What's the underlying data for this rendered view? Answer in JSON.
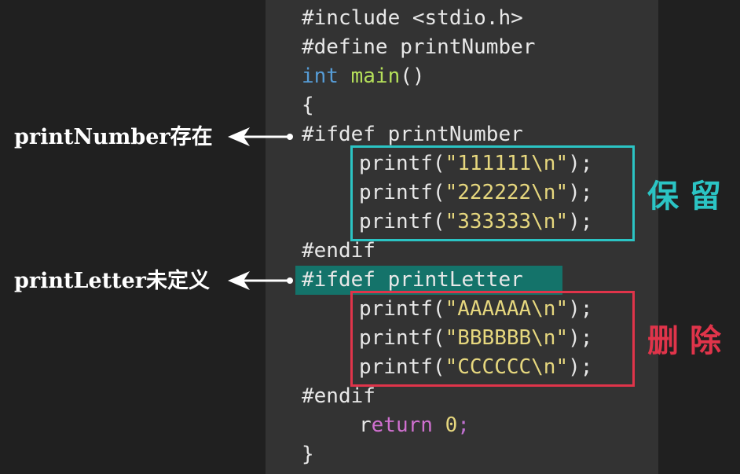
{
  "code": {
    "line1": "#include <stdio.h>",
    "line2": "#define printNumber",
    "line3_kw": "int",
    "line3_fn": "main",
    "line3_rest": "()",
    "line4": "{",
    "line5": "#ifdef printNumber",
    "p1_pre": "printf(",
    "p1_str": "\"111111\\n\"",
    "p1_post": ");",
    "p2_pre": "printf(",
    "p2_str": "\"222222\\n\"",
    "p2_post": ");",
    "p3_pre": "printf(",
    "p3_str": "\"333333\\n\"",
    "p3_post": ");",
    "endif1": "#endif",
    "line_ifdef2": "#ifdef printLetter",
    "p4_pre": "printf(",
    "p4_str": "\"AAAAAA\\n\"",
    "p4_post": ");",
    "p5_pre": "printf(",
    "p5_str": "\"BBBBBB\\n\"",
    "p5_post": ");",
    "p6_pre": "printf(",
    "p6_str": "\"CCCCCC\\n\"",
    "p6_post": ");",
    "endif2": "#endif",
    "ret_r": "r",
    "ret_kw": "eturn",
    "ret_num": "0",
    "ret_semi": ";",
    "close": "}"
  },
  "annotations": {
    "keep_label": "保留",
    "delete_label": "删除",
    "number_note": "printNumber存在",
    "letter_note": "printLetter未定义"
  },
  "colors": {
    "keep": "#2bc4c4",
    "delete": "#e0344a",
    "highlight": "#14736a"
  }
}
